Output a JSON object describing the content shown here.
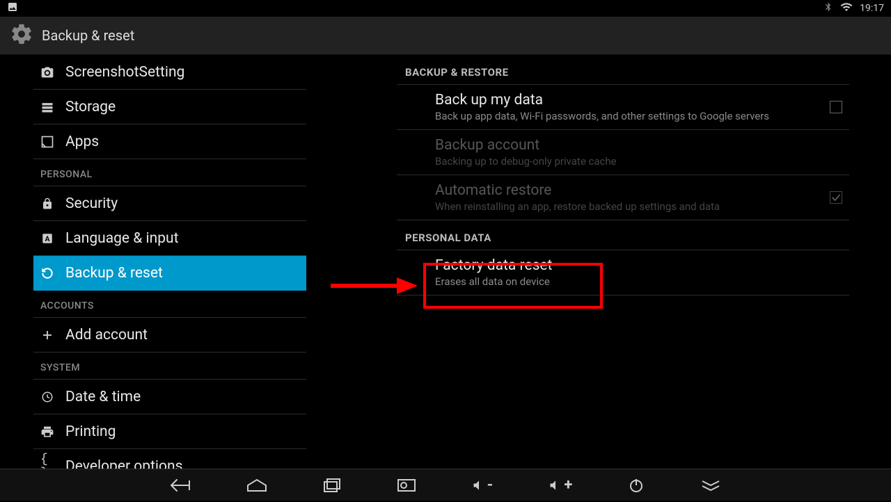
{
  "status": {
    "time": "19:17"
  },
  "title": "Backup & reset",
  "sidebar": [
    {
      "type": "item",
      "icon": "camera",
      "label": "ScreenshotSetting",
      "name": "sidebar-item-screenshot"
    },
    {
      "type": "item",
      "icon": "storage",
      "label": "Storage",
      "name": "sidebar-item-storage"
    },
    {
      "type": "item",
      "icon": "apps",
      "label": "Apps",
      "name": "sidebar-item-apps"
    },
    {
      "type": "header",
      "label": "PERSONAL"
    },
    {
      "type": "item",
      "icon": "lock",
      "label": "Security",
      "name": "sidebar-item-security"
    },
    {
      "type": "item",
      "icon": "language",
      "label": "Language & input",
      "name": "sidebar-item-language"
    },
    {
      "type": "item",
      "icon": "backup",
      "label": "Backup & reset",
      "name": "sidebar-item-backup",
      "active": true
    },
    {
      "type": "header",
      "label": "ACCOUNTS"
    },
    {
      "type": "item",
      "icon": "add",
      "label": "Add account",
      "name": "sidebar-item-add-account"
    },
    {
      "type": "header",
      "label": "SYSTEM"
    },
    {
      "type": "item",
      "icon": "clock",
      "label": "Date & time",
      "name": "sidebar-item-datetime"
    },
    {
      "type": "item",
      "icon": "print",
      "label": "Printing",
      "name": "sidebar-item-printing"
    },
    {
      "type": "item",
      "icon": "dev",
      "label": "Developer options",
      "name": "sidebar-item-developer"
    }
  ],
  "content": {
    "sections": [
      {
        "header": "BACKUP & RESTORE",
        "items": [
          {
            "title": "Back up my data",
            "sub": "Back up app data, Wi-Fi passwords, and other settings to Google servers",
            "checkbox": true,
            "name": "item-backup-data"
          },
          {
            "title": "Backup account",
            "sub": "Backing up to debug-only private cache",
            "disabled": true,
            "name": "item-backup-account"
          },
          {
            "title": "Automatic restore",
            "sub": "When reinstalling an app, restore backed up settings and data",
            "disabled": true,
            "checkbox": true,
            "checked": true,
            "name": "item-auto-restore"
          }
        ]
      },
      {
        "header": "PERSONAL DATA",
        "items": [
          {
            "title": "Factory data reset",
            "sub": "Erases all data on device",
            "name": "item-factory-reset",
            "highlighted": true
          }
        ]
      }
    ]
  },
  "nav": [
    "back",
    "home",
    "recent",
    "screenshot",
    "vol-down",
    "vol-up",
    "power",
    "expand"
  ]
}
